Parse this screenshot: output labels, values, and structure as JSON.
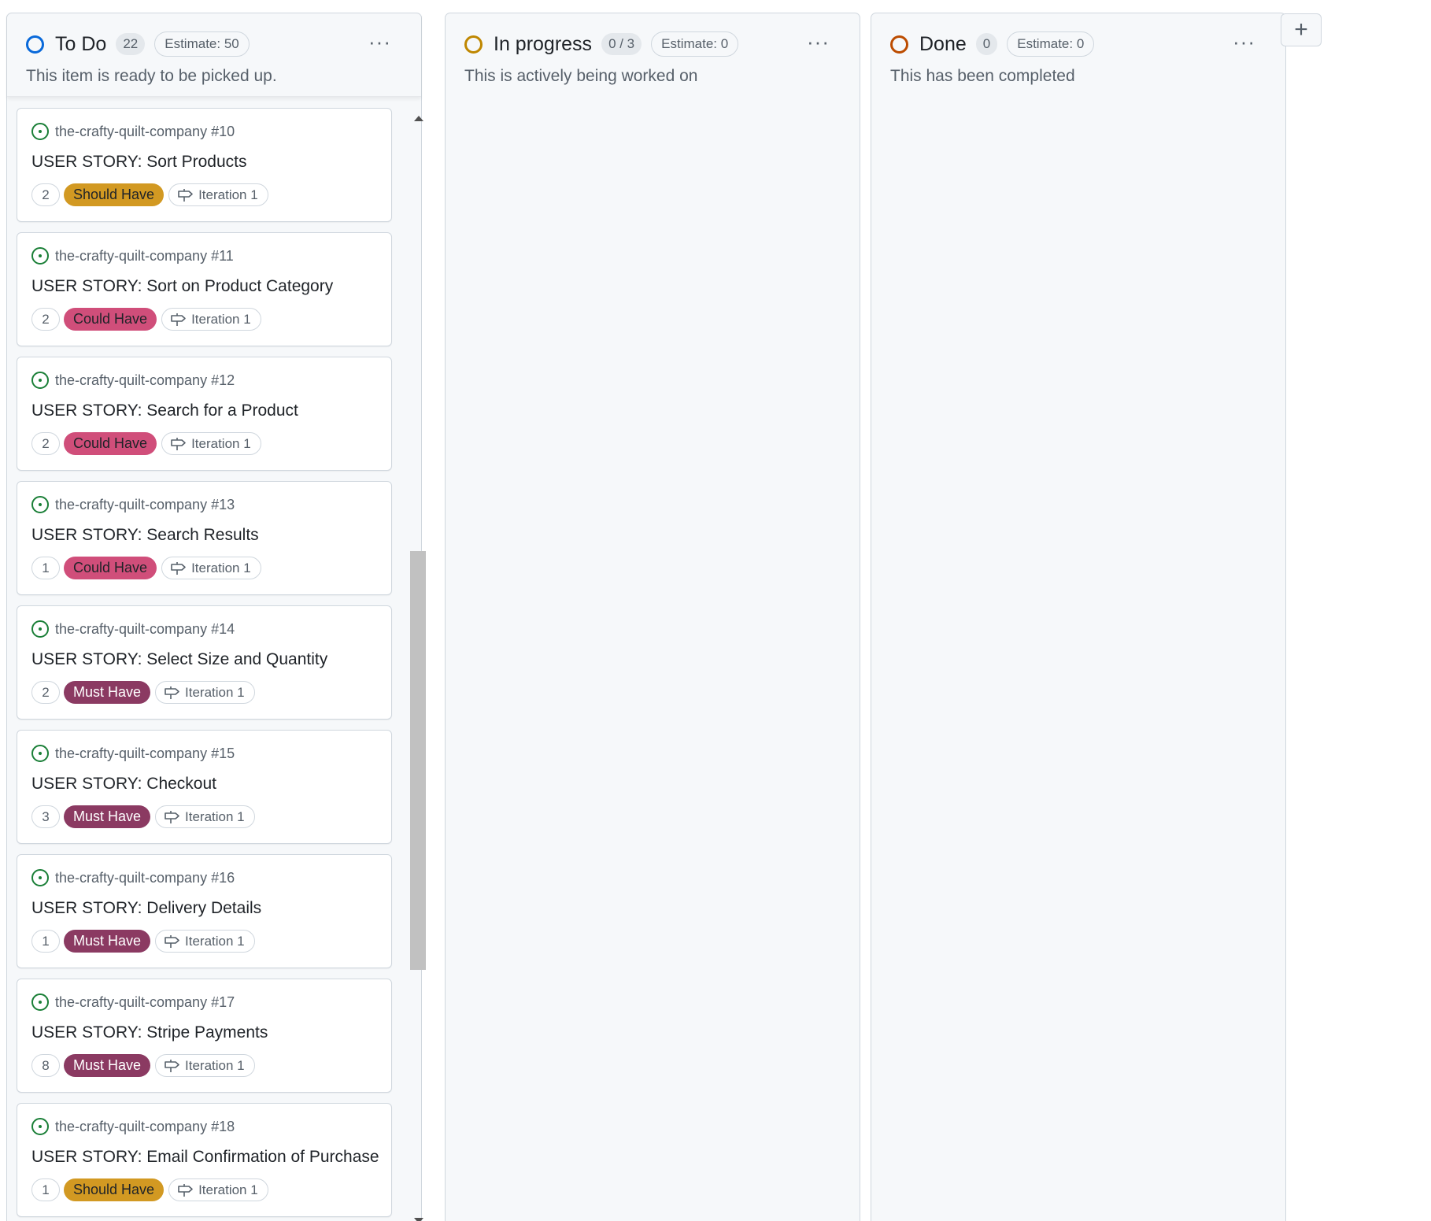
{
  "colors": {
    "todo_ring": "#0969da",
    "in_progress_ring": "#bf8700",
    "done_ring": "#bc4c00",
    "issue_open": "#1a7f37",
    "should_have": "#d29922",
    "could_have": "#d04e7a",
    "must_have": "#8b3a62"
  },
  "columns": [
    {
      "title": "To Do",
      "count": "22",
      "estimate": "Estimate: 50",
      "description": "This item is ready to be picked up."
    },
    {
      "title": "In progress",
      "count": "0 / 3",
      "estimate": "Estimate: 0",
      "description": "This is actively being worked on"
    },
    {
      "title": "Done",
      "count": "0",
      "estimate": "Estimate: 0",
      "description": "This has been completed"
    }
  ],
  "more_icon": "···",
  "add_icon": "+",
  "iteration_icon": "milestone-icon",
  "cards": [
    {
      "repo": "the-crafty-quilt-company #10",
      "title": "USER STORY: Sort Products",
      "points": "2",
      "priority": "Should Have",
      "iteration": "Iteration 1"
    },
    {
      "repo": "the-crafty-quilt-company #11",
      "title": "USER STORY: Sort on Product Category",
      "points": "2",
      "priority": "Could Have",
      "iteration": "Iteration 1"
    },
    {
      "repo": "the-crafty-quilt-company #12",
      "title": "USER STORY: Search for a Product",
      "points": "2",
      "priority": "Could Have",
      "iteration": "Iteration 1"
    },
    {
      "repo": "the-crafty-quilt-company #13",
      "title": "USER STORY: Search Results",
      "points": "1",
      "priority": "Could Have",
      "iteration": "Iteration 1"
    },
    {
      "repo": "the-crafty-quilt-company #14",
      "title": "USER STORY: Select Size and Quantity",
      "points": "2",
      "priority": "Must Have",
      "iteration": "Iteration 1"
    },
    {
      "repo": "the-crafty-quilt-company #15",
      "title": "USER STORY: Checkout",
      "points": "3",
      "priority": "Must Have",
      "iteration": "Iteration 1"
    },
    {
      "repo": "the-crafty-quilt-company #16",
      "title": "USER STORY: Delivery Details",
      "points": "1",
      "priority": "Must Have",
      "iteration": "Iteration 1"
    },
    {
      "repo": "the-crafty-quilt-company #17",
      "title": "USER STORY: Stripe Payments",
      "points": "8",
      "priority": "Must Have",
      "iteration": "Iteration 1"
    },
    {
      "repo": "the-crafty-quilt-company #18",
      "title": "USER STORY: Email Confirmation of Purchase",
      "points": "1",
      "priority": "Should Have",
      "iteration": "Iteration 1"
    }
  ]
}
